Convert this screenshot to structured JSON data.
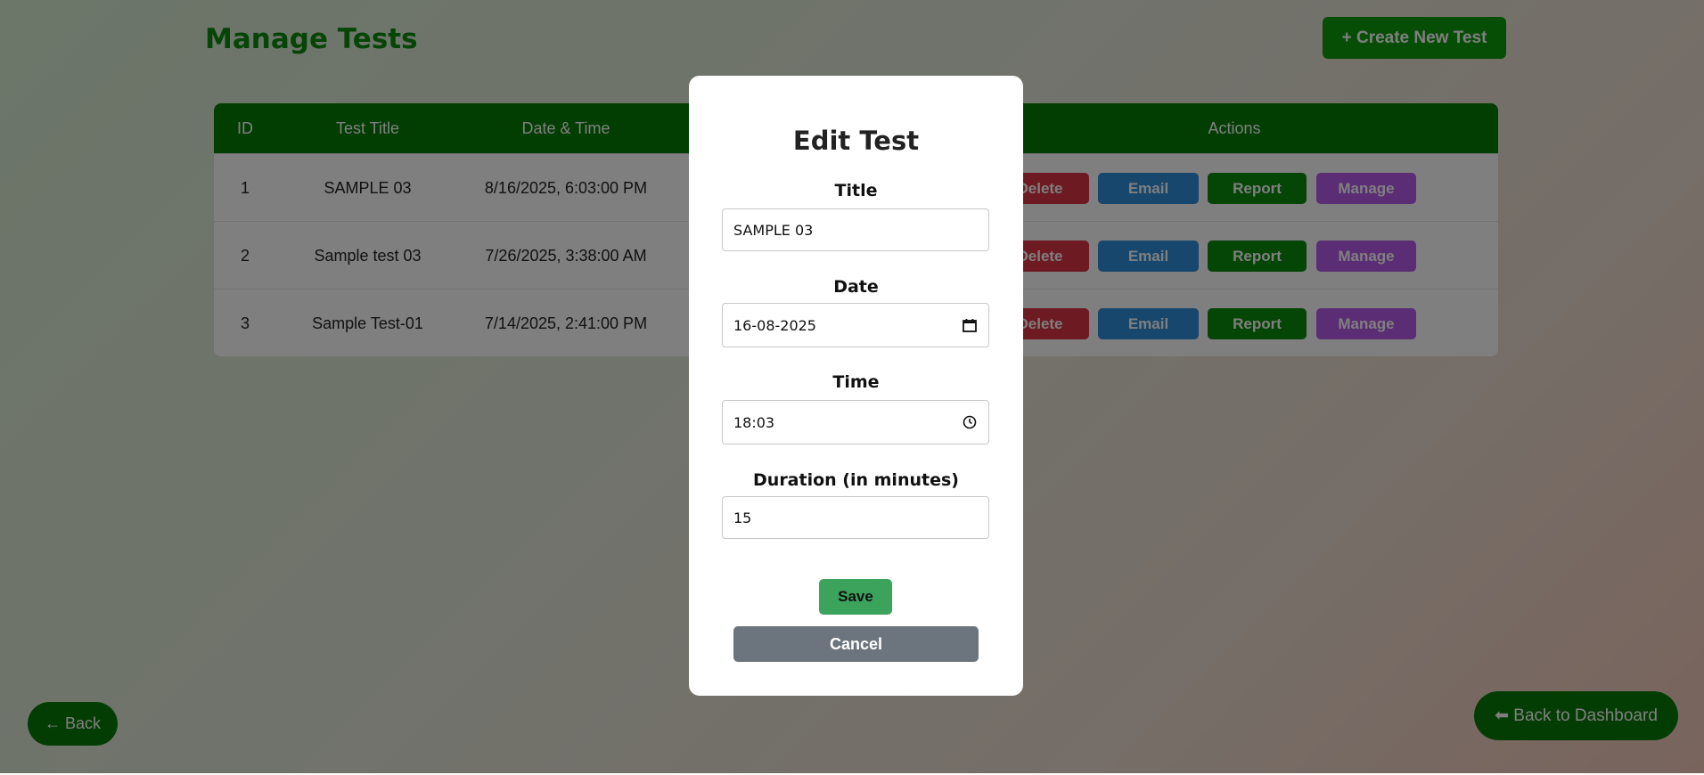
{
  "page": {
    "title": "Manage Tests",
    "create_button": "+ Create New Test",
    "back_button": "← Back",
    "dashboard_button": "⬅ Back to Dashboard"
  },
  "table": {
    "headers": {
      "id": "ID",
      "title": "Test Title",
      "datetime": "Date & Time",
      "actions": "Actions"
    },
    "rows": [
      {
        "id": "1",
        "title": "SAMPLE 03",
        "datetime": "8/16/2025, 6:03:00 PM",
        "delete": "Delete",
        "email": "Email",
        "report": "Report",
        "manage": "Manage"
      },
      {
        "id": "2",
        "title": "Sample test 03",
        "datetime": "7/26/2025, 3:38:00 AM",
        "delete": "Delete",
        "email": "Email",
        "report": "Report",
        "manage": "Manage"
      },
      {
        "id": "3",
        "title": "Sample Test-01",
        "datetime": "7/14/2025, 2:41:00 PM",
        "delete": "Delete",
        "email": "Email",
        "report": "Report",
        "manage": "Manage"
      }
    ]
  },
  "modal": {
    "title": "Edit Test",
    "fields": {
      "title": {
        "label": "Title",
        "value": "SAMPLE 03"
      },
      "date": {
        "label": "Date",
        "value": "16-08-2025",
        "icon": "calendar-icon"
      },
      "time": {
        "label": "Time",
        "value": "18:03",
        "icon": "clock-icon"
      },
      "duration": {
        "label": "Duration (in minutes)",
        "value": "15"
      }
    },
    "save_label": "Save",
    "cancel_label": "Cancel"
  },
  "colors": {
    "primary_green": "#087a08",
    "delete": "#dc3545",
    "email": "#2f8fd8",
    "manage": "#b65ae8",
    "cancel": "#6c757d",
    "save": "#3ca35c"
  }
}
